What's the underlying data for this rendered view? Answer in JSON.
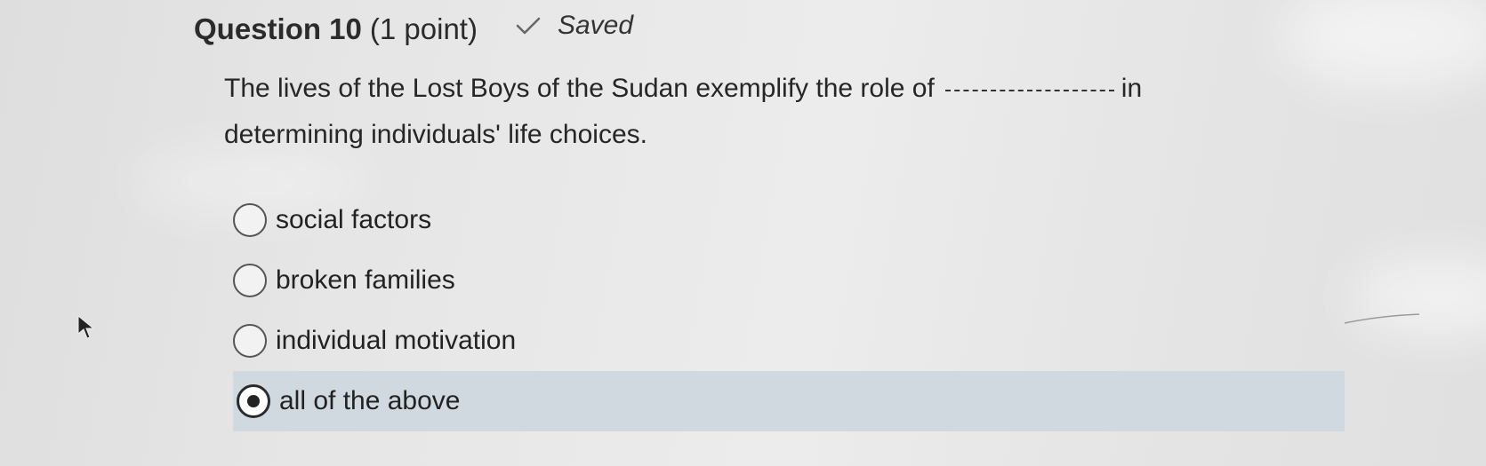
{
  "question": {
    "title": "Question 10",
    "points": "(1 point)",
    "status_icon": "check-icon",
    "status_text": "Saved",
    "prompt_before_blank": "The lives of the Lost Boys of the Sudan exemplify the role of",
    "prompt_after_blank": "in determining individuals' life choices."
  },
  "options": [
    {
      "label": "social factors",
      "selected": false
    },
    {
      "label": "broken families",
      "selected": false
    },
    {
      "label": "individual motivation",
      "selected": false
    },
    {
      "label": "all of the above",
      "selected": true
    }
  ],
  "colors": {
    "selected_row_bg": "#cfd9df",
    "text": "#262626"
  }
}
